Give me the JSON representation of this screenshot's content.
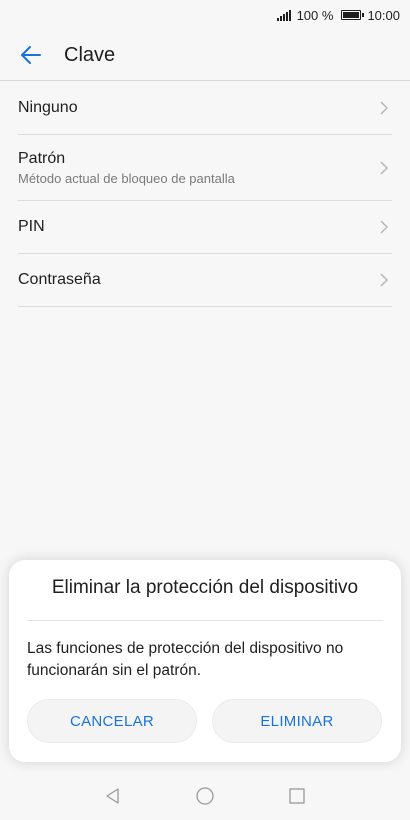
{
  "status_bar": {
    "battery_text": "100 %",
    "time": "10:00"
  },
  "header": {
    "title": "Clave",
    "back_icon": "arrow-left-icon"
  },
  "list": {
    "items": [
      {
        "label": "Ninguno",
        "subtitle": ""
      },
      {
        "label": "Patrón",
        "subtitle": "Método actual de bloqueo de pantalla"
      },
      {
        "label": "PIN",
        "subtitle": ""
      },
      {
        "label": "Contraseña",
        "subtitle": ""
      }
    ]
  },
  "dialog": {
    "title": "Eliminar la protección del dispositivo",
    "message": "Las funciones de protección del dispositivo no funcionarán sin el patrón.",
    "cancel_label": "CANCELAR",
    "confirm_label": "ELIMINAR"
  },
  "nav_bar": {
    "icons": [
      "back-triangle-icon",
      "home-circle-icon",
      "recents-square-icon"
    ]
  },
  "colors": {
    "accent": "#1a73d9",
    "background": "#f7f7f7",
    "dialog_background": "#ffffff"
  }
}
